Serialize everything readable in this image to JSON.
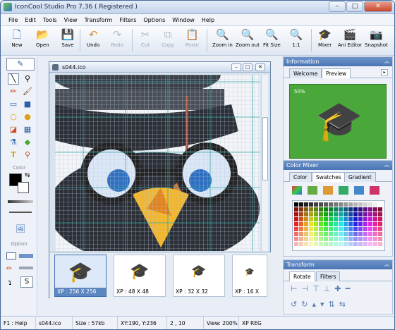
{
  "window": {
    "title": "IconCool Studio Pro 7.36 ( Registered )",
    "buttons": {
      "minimize": "–",
      "maximize": "□",
      "close": "✕"
    }
  },
  "menu": [
    "File",
    "Edit",
    "Tools",
    "View",
    "Transform",
    "Filters",
    "Options",
    "Window",
    "Help"
  ],
  "toolbar": {
    "new": "New",
    "open": "Open",
    "save": "Save",
    "undo": "Undo",
    "redo": "Redo",
    "cut": "Cut",
    "copy": "Copy",
    "paste": "Paste",
    "zoom_in": "Zoom in",
    "zoom_out": "Zoom out",
    "fit_size": "Fit Size",
    "one_to_one": "1:1",
    "mixer": "Mixer",
    "ani_editor": "Ani Editor",
    "snapshot": "Snapshot"
  },
  "left_tools": {
    "color_label": "Color",
    "option_label": "Option",
    "fg_color": "#000000",
    "bg_color": "#ffffff"
  },
  "document": {
    "title": "s044.ico",
    "zoom_mark": "50%"
  },
  "thumbnails": [
    {
      "caption": "XP : 256 X 256"
    },
    {
      "caption": "XP : 48 X 48"
    },
    {
      "caption": "XP : 32 X 32"
    },
    {
      "caption": "XP : 16 X"
    }
  ],
  "info_panel": {
    "title": "Information",
    "tabs": [
      "Welcome",
      "Preview"
    ],
    "zoom_label": "50%"
  },
  "color_mixer": {
    "title": "Color Mixer",
    "tabs": [
      "Color",
      "Swatches",
      "Gradient"
    ]
  },
  "transform_panel": {
    "title": "Transform",
    "tabs": [
      "Rotate",
      "Filters"
    ]
  },
  "status": {
    "help": "F1 : Help",
    "file": "s044.ico",
    "size": "Size : 57kb",
    "coords": "XY:190, Y:236",
    "selection": "2 , 10",
    "view": "View: 200%",
    "mode": "XP REG"
  },
  "colors": {
    "title_blue": "#4a75b4",
    "accent_green": "#4aa83a",
    "canvas_grid": "#9fb1c9"
  }
}
